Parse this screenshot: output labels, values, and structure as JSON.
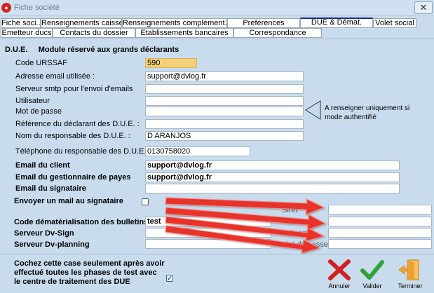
{
  "window": {
    "title": "Fiche société",
    "app_icon": "app-badge-icon",
    "close_glyph": "✕"
  },
  "tabs_row1": [
    {
      "label": "Fiche soci..."
    },
    {
      "label": "Renseignements caisses"
    },
    {
      "label": "Renseignements complément..."
    },
    {
      "label": "Préférences"
    },
    {
      "label": "DUE & Démat.",
      "active": true
    },
    {
      "label": "Volet social"
    }
  ],
  "tabs_row2": [
    {
      "label": "Emetteur ducs"
    },
    {
      "label": "Contacts du dossier"
    },
    {
      "label": "Etablissements bancaires"
    },
    {
      "label": "Correspondance"
    }
  ],
  "section": {
    "prefix": "D.U.E.",
    "title": "Module réservé aux grands déclarants"
  },
  "form": {
    "code_urssaf": {
      "label": "Code URSSAF",
      "value": "590"
    },
    "email_used": {
      "label": "Adresse email utilisée :",
      "value": "support@dvlog.fr"
    },
    "smtp": {
      "label": "Serveur smtp pour l'envoi d'emails",
      "value": ""
    },
    "user": {
      "label": "Utilisateur",
      "value": ""
    },
    "password": {
      "label": "Mot de passe",
      "value": ""
    },
    "declarant_ref": {
      "label": "Référence du déclarant des D.U.E. :",
      "value": ""
    },
    "responsible_name": {
      "label": "Nom du responsable des D.U.E. :",
      "value": "D ARANJOS"
    },
    "responsible_phone": {
      "label": "Téléphone du responsable des D.U.E. :",
      "value": "0130758020"
    },
    "client_email": {
      "label": "Email du client",
      "value": "support@dvlog.fr"
    },
    "payroll_email": {
      "label": "Email du gestionnaire de payes",
      "value": "support@dvlog.fr"
    },
    "signatory_email": {
      "label": "Email du signataire",
      "value": ""
    },
    "send_mail_signatory": {
      "label": "Envoyer un mail au signataire",
      "checked": false
    },
    "dematerialisation_code": {
      "label": "Code dématérialisation des bulletins",
      "value": "test"
    },
    "dv_sign": {
      "label": "Serveur Dv-Sign",
      "value": ""
    },
    "dv_planning": {
      "label": "Serveur Dv-planning",
      "value": ""
    },
    "siret": {
      "label": "Siret",
      "value": ""
    },
    "nom": {
      "label": "Nom",
      "value": ""
    },
    "prenom": {
      "label": "Prénom",
      "value": ""
    },
    "mot_de_passe": {
      "label": "Mot de passe",
      "value": ""
    }
  },
  "hint": "A renseigner uniquement si mode authentifié",
  "bottom": {
    "note": "Cochez cette case seulement après avoir effectué toutes les phases de test avec le centre de traitement des DUE",
    "checked": true
  },
  "actions": {
    "cancel": "Annuler",
    "validate": "Valider",
    "exit": "Terminer"
  },
  "colors": {
    "background": "#c8dcee",
    "highlight_field": "#f5d07a",
    "arrow_red": "#e8302c",
    "cancel_red": "#d21f1f",
    "validate_green": "#2fa336",
    "exit_orange": "#f0a030"
  }
}
